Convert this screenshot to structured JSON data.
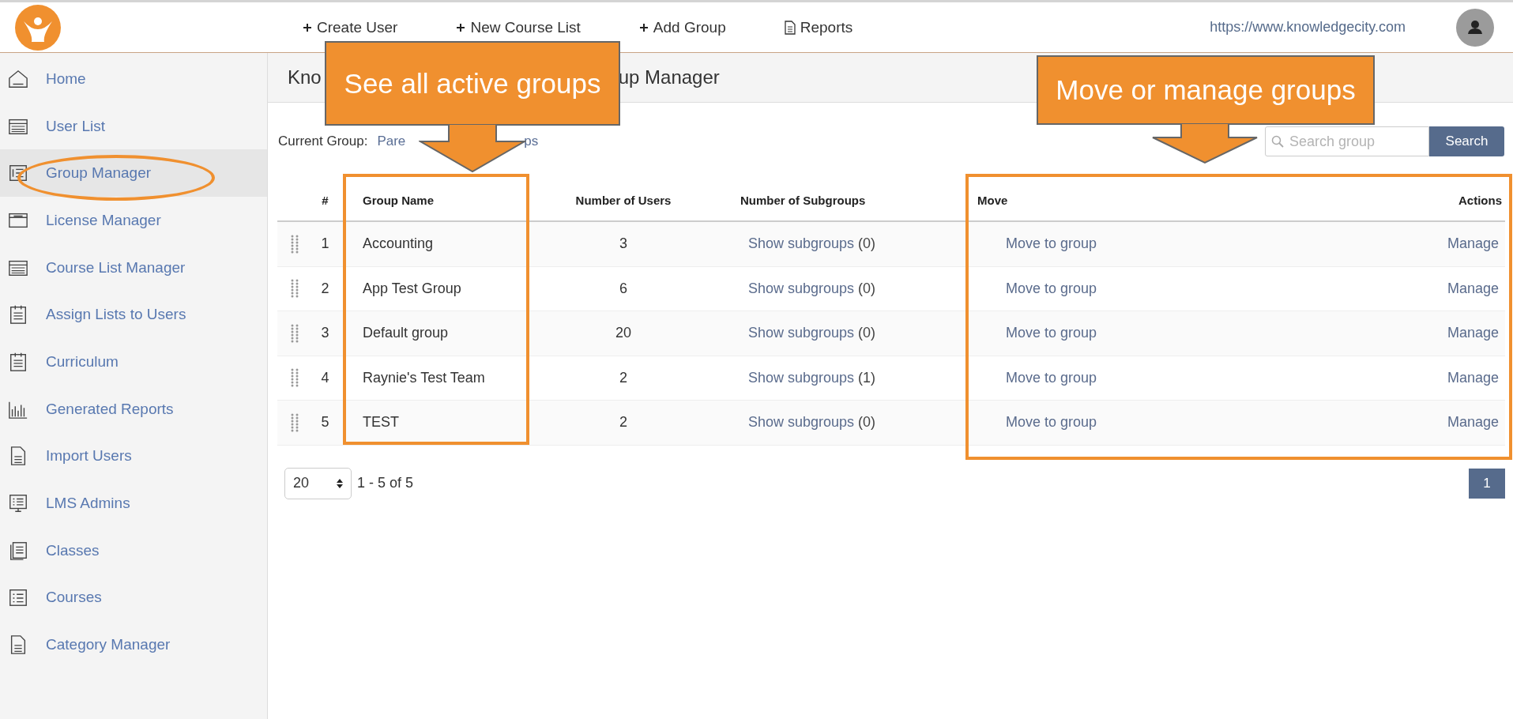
{
  "topbar": {
    "actions": [
      {
        "kind": "add",
        "label": "Create User"
      },
      {
        "kind": "add",
        "label": "New Course List"
      },
      {
        "kind": "add",
        "label": "Add Group"
      },
      {
        "kind": "report",
        "label": "Reports"
      }
    ],
    "site_url": "https://www.knowledgecity.com"
  },
  "sidebar": {
    "items": [
      {
        "kind": "home",
        "label": "Home",
        "selected": false
      },
      {
        "kind": "list",
        "label": "User List",
        "selected": false
      },
      {
        "kind": "group",
        "label": "Group Manager",
        "selected": true
      },
      {
        "kind": "license",
        "label": "License Manager",
        "selected": false
      },
      {
        "kind": "list",
        "label": "Course List Manager",
        "selected": false
      },
      {
        "kind": "clipboard",
        "label": "Assign Lists to Users",
        "selected": false
      },
      {
        "kind": "calendar",
        "label": "Curriculum",
        "selected": false
      },
      {
        "kind": "chart",
        "label": "Generated Reports",
        "selected": false
      },
      {
        "kind": "doc",
        "label": "Import Users",
        "selected": false
      },
      {
        "kind": "admin",
        "label": "LMS Admins",
        "selected": false
      },
      {
        "kind": "pages",
        "label": "Classes",
        "selected": false
      },
      {
        "kind": "outline",
        "label": "Courses",
        "selected": false
      },
      {
        "kind": "doc",
        "label": "Category Manager",
        "selected": false
      }
    ]
  },
  "page_title": {
    "visible_parts": [
      "Kno",
      "up Manager"
    ]
  },
  "current_group": {
    "label": "Current Group:",
    "link_parts": [
      "Pare",
      "ps"
    ]
  },
  "search": {
    "placeholder": "Search group",
    "button": "Search"
  },
  "table": {
    "columns": [
      "#",
      "Group Name",
      "Number of Users",
      "Number of Subgroups",
      "Move",
      "Actions"
    ],
    "rows": [
      {
        "index": "1",
        "name": "Accounting",
        "users": "3",
        "subgroups_link": "Show subgroups",
        "subgroups_count": "(0)",
        "move": "Move to group",
        "action": "Manage"
      },
      {
        "index": "2",
        "name": "App Test Group",
        "users": "6",
        "subgroups_link": "Show subgroups",
        "subgroups_count": "(0)",
        "move": "Move to group",
        "action": "Manage"
      },
      {
        "index": "3",
        "name": "Default group",
        "users": "20",
        "subgroups_link": "Show subgroups",
        "subgroups_count": "(0)",
        "move": "Move to group",
        "action": "Manage"
      },
      {
        "index": "4",
        "name": "Raynie's Test Team",
        "users": "2",
        "subgroups_link": "Show subgroups",
        "subgroups_count": "(1)",
        "move": "Move to group",
        "action": "Manage"
      },
      {
        "index": "5",
        "name": "TEST",
        "users": "2",
        "subgroups_link": "Show subgroups",
        "subgroups_count": "(0)",
        "move": "Move to group",
        "action": "Manage"
      }
    ]
  },
  "pagination": {
    "page_size": "20",
    "range": "1 - 5 of 5",
    "pages": [
      {
        "label": "1",
        "selected": true
      }
    ]
  },
  "annotations": [
    {
      "kind": "callout",
      "text": "See all active groups"
    },
    {
      "kind": "callout",
      "text": "Move or manage groups"
    }
  ]
}
